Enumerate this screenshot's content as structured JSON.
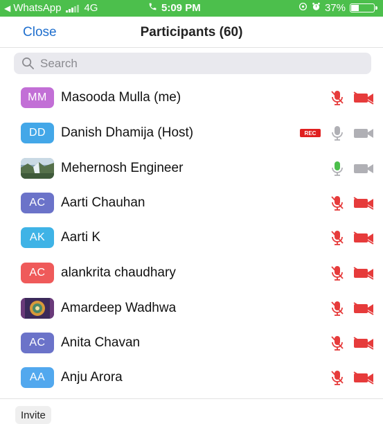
{
  "status_bar": {
    "back_app": "WhatsApp",
    "network": "4G",
    "time": "5:09 PM",
    "battery": "37%",
    "battery_level": 0.37
  },
  "header": {
    "close_label": "Close",
    "title": "Participants (60)"
  },
  "search": {
    "placeholder": "Search"
  },
  "participants": [
    {
      "initials": "MM",
      "name": "Masooda Mulla (me)",
      "avatar_color": "#c26fd6",
      "avatar_type": "initials",
      "mic": "muted",
      "camera": "off",
      "recording": false
    },
    {
      "initials": "DD",
      "name": "Danish Dhamija (Host)",
      "avatar_color": "#43a7e8",
      "avatar_type": "initials",
      "mic": "on",
      "camera": "on",
      "recording": true,
      "rec_label": "REC"
    },
    {
      "initials": "",
      "name": "Mehernosh Engineer",
      "avatar_type": "photo",
      "mic": "active",
      "camera": "on",
      "recording": false
    },
    {
      "initials": "AC",
      "name": "Aarti Chauhan",
      "avatar_color": "#6b73c9",
      "avatar_type": "initials",
      "mic": "muted",
      "camera": "off",
      "recording": false
    },
    {
      "initials": "AK",
      "name": "Aarti K",
      "avatar_color": "#3fb3e6",
      "avatar_type": "initials",
      "mic": "muted",
      "camera": "off",
      "recording": false
    },
    {
      "initials": "AC",
      "name": "alankrita chaudhary",
      "avatar_color": "#ef5a5a",
      "avatar_type": "initials",
      "mic": "muted",
      "camera": "off",
      "recording": false
    },
    {
      "initials": "",
      "name": "Amardeep Wadhwa",
      "avatar_type": "photo",
      "mic": "muted",
      "camera": "off",
      "recording": false
    },
    {
      "initials": "AC",
      "name": "Anita Chavan",
      "avatar_color": "#6b73c9",
      "avatar_type": "initials",
      "mic": "muted",
      "camera": "off",
      "recording": false
    },
    {
      "initials": "AA",
      "name": "Anju Arora",
      "avatar_color": "#52a8ee",
      "avatar_type": "initials",
      "mic": "muted",
      "camera": "off",
      "recording": false
    }
  ],
  "footer": {
    "invite_label": "Invite"
  },
  "colors": {
    "status_bar": "#4cbf4c",
    "accent": "#1f6fce",
    "muted_red": "#e63b3b",
    "active_green": "#4cbf4c",
    "neutral_icon": "#b0b0b5"
  }
}
